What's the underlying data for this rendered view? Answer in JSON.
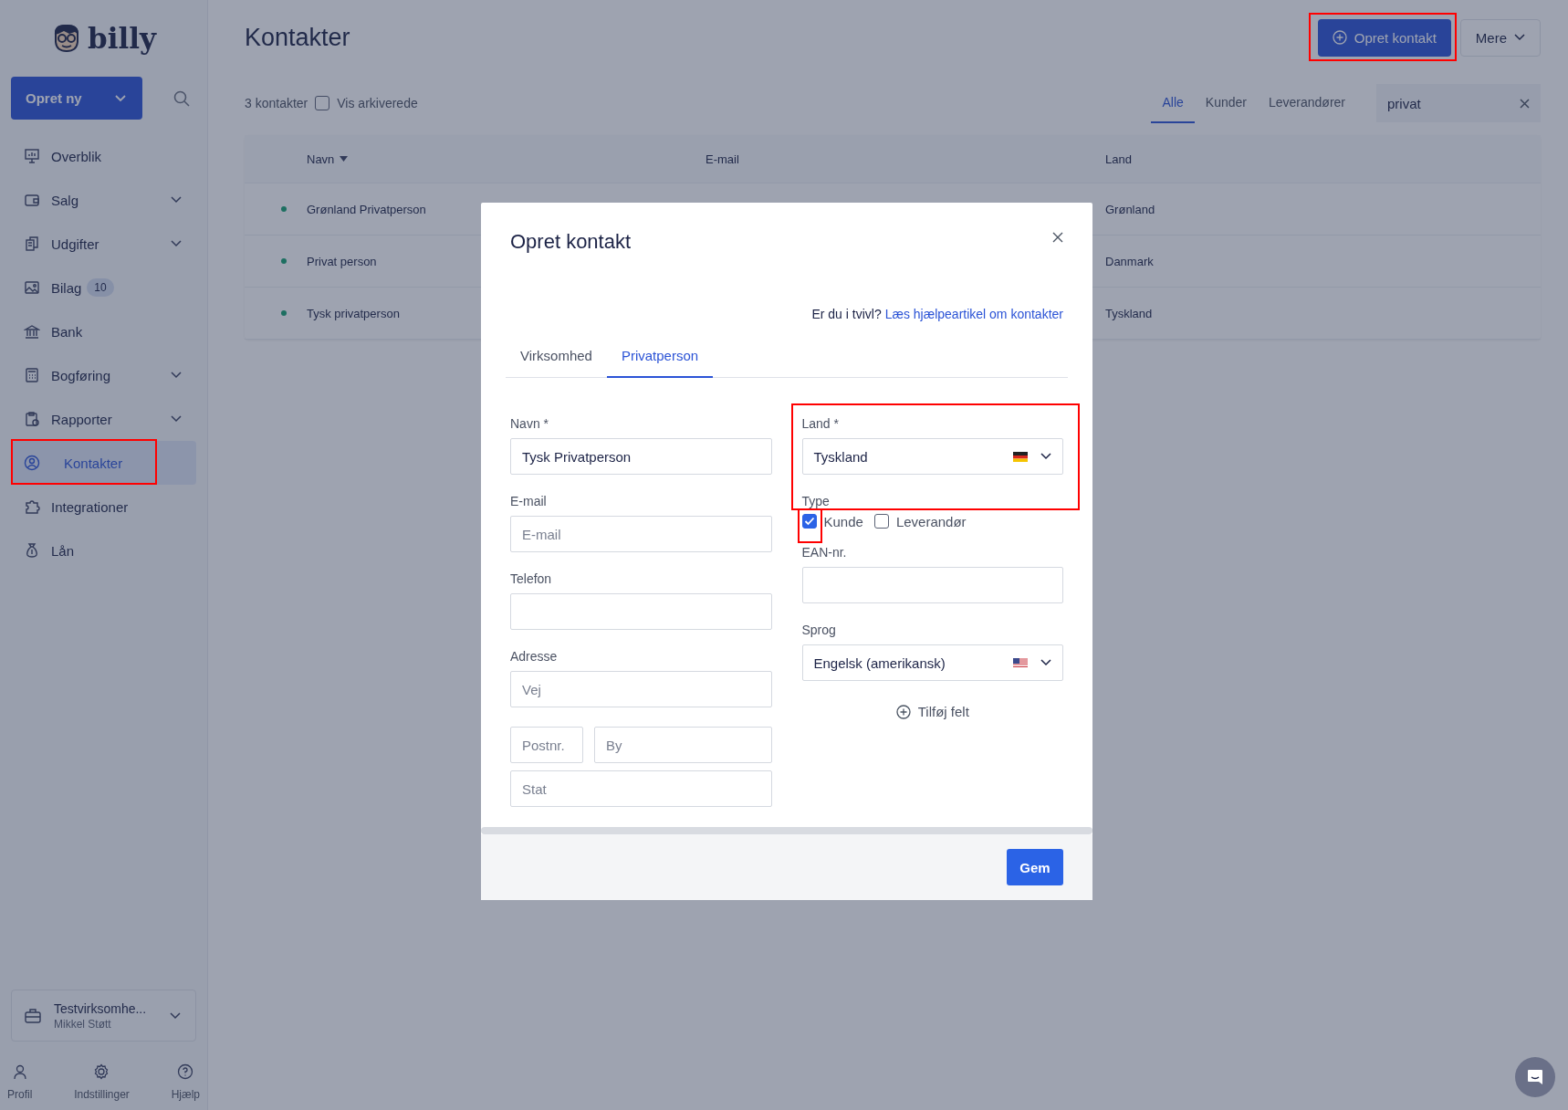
{
  "sidebar": {
    "logo": "billy",
    "create_button": {
      "label": "Opret ny"
    },
    "nav": [
      {
        "label": "Overblik",
        "expandable": false,
        "selected": false,
        "highlighted": false
      },
      {
        "label": "Salg",
        "expandable": true,
        "selected": false,
        "highlighted": false
      },
      {
        "label": "Udgifter",
        "expandable": true,
        "selected": false,
        "highlighted": false
      },
      {
        "label": "Bilag",
        "badge": "10",
        "expandable": false,
        "selected": false,
        "highlighted": false
      },
      {
        "label": "Bank",
        "expandable": false,
        "selected": false,
        "highlighted": false
      },
      {
        "label": "Bogføring",
        "expandable": true,
        "selected": false,
        "highlighted": false
      },
      {
        "label": "Rapporter",
        "expandable": true,
        "selected": false,
        "highlighted": false
      },
      {
        "label": "Kontakter",
        "expandable": false,
        "selected": true,
        "highlighted": true
      },
      {
        "label": "Integrationer",
        "expandable": false,
        "selected": false,
        "highlighted": false
      },
      {
        "label": "Lån",
        "expandable": false,
        "selected": false,
        "highlighted": false
      }
    ],
    "account": {
      "company": "Testvirksomhe...",
      "user": "Mikkel Støtt"
    },
    "footer": [
      {
        "label": "Profil"
      },
      {
        "label": "Indstillinger"
      },
      {
        "label": "Hjælp"
      }
    ]
  },
  "page": {
    "title": "Kontakter",
    "primary_button": {
      "label": "Opret kontakt",
      "highlighted": true
    },
    "more_button": {
      "label": "Mere"
    },
    "count": "3 kontakter",
    "show_archived": {
      "label": "Vis arkiverede",
      "checked": false
    },
    "filters": [
      {
        "label": "Alle",
        "selected": true
      },
      {
        "label": "Kunder",
        "selected": false
      },
      {
        "label": "Leverandører",
        "selected": false
      }
    ],
    "search": {
      "value": "privat"
    },
    "table": {
      "columns": [
        "Navn",
        "E-mail",
        "Land"
      ],
      "rows": [
        {
          "name": "Grønland Privatperson",
          "country": "Grønland"
        },
        {
          "name": "Privat person",
          "country": "Danmark"
        },
        {
          "name": "Tysk privatperson",
          "country": "Tyskland"
        }
      ]
    }
  },
  "modal": {
    "title": "Opret kontakt",
    "help_text": "Er du i tvivl?",
    "help_link": "Læs hjælpeartikel om kontakter",
    "tabs": [
      {
        "label": "Virksomhed",
        "selected": false
      },
      {
        "label": "Privatperson",
        "selected": true
      }
    ],
    "name": {
      "label": "Navn *",
      "value": "Tysk Privatperson"
    },
    "email": {
      "label": "E-mail",
      "placeholder": "E-mail"
    },
    "phone": {
      "label": "Telefon"
    },
    "address": {
      "label": "Adresse",
      "street": {
        "placeholder": "Vej"
      },
      "zip": {
        "placeholder": "Postnr."
      },
      "city": {
        "placeholder": "By"
      },
      "state": {
        "placeholder": "Stat"
      }
    },
    "country": {
      "label": "Land *",
      "value": "Tyskland",
      "highlighted": true
    },
    "type": {
      "label": "Type",
      "options": [
        {
          "label": "Kunde",
          "checked": true,
          "highlighted": true
        },
        {
          "label": "Leverandør",
          "checked": false,
          "highlighted": false
        }
      ]
    },
    "ean": {
      "label": "EAN-nr."
    },
    "language": {
      "label": "Sprog",
      "value": "Engelsk (amerikansk)"
    },
    "add_field": "Tilføj felt",
    "save_button": "Gem"
  }
}
